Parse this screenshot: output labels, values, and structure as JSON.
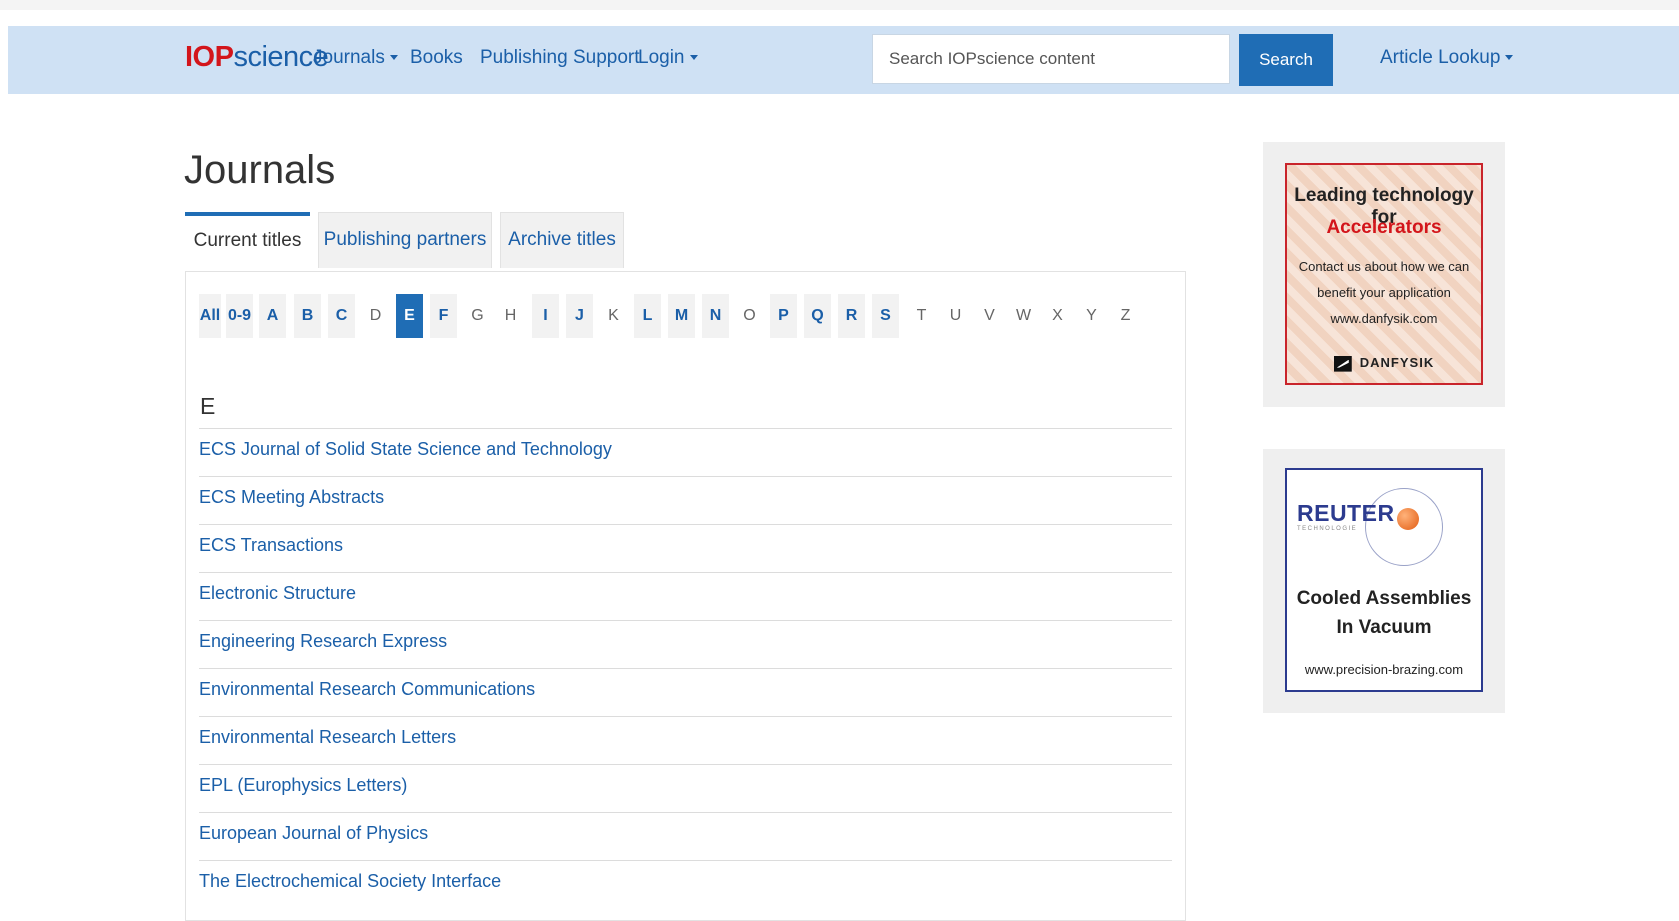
{
  "nav": {
    "logo_bold": "IOP",
    "logo_rest": "science",
    "journals": "Journals",
    "books": "Books",
    "publishing_support": "Publishing Support",
    "login": "Login",
    "search_placeholder": "Search IOPscience content",
    "search_button": "Search",
    "article_lookup": "Article Lookup"
  },
  "page": {
    "title": "Journals",
    "tabs": [
      {
        "label": "Current titles",
        "active": true
      },
      {
        "label": "Publishing partners",
        "active": false
      },
      {
        "label": "Archive titles",
        "active": false
      }
    ],
    "letters": [
      {
        "label": "All",
        "state": "has"
      },
      {
        "label": "0-9",
        "state": "has"
      },
      {
        "label": "A",
        "state": "has"
      },
      {
        "label": "B",
        "state": "has"
      },
      {
        "label": "C",
        "state": "has"
      },
      {
        "label": "D",
        "state": "no"
      },
      {
        "label": "E",
        "state": "sel"
      },
      {
        "label": "F",
        "state": "has"
      },
      {
        "label": "G",
        "state": "no"
      },
      {
        "label": "H",
        "state": "no"
      },
      {
        "label": "I",
        "state": "has"
      },
      {
        "label": "J",
        "state": "has"
      },
      {
        "label": "K",
        "state": "no"
      },
      {
        "label": "L",
        "state": "has"
      },
      {
        "label": "M",
        "state": "has"
      },
      {
        "label": "N",
        "state": "has"
      },
      {
        "label": "O",
        "state": "no"
      },
      {
        "label": "P",
        "state": "has"
      },
      {
        "label": "Q",
        "state": "has"
      },
      {
        "label": "R",
        "state": "has"
      },
      {
        "label": "S",
        "state": "has"
      },
      {
        "label": "T",
        "state": "no"
      },
      {
        "label": "U",
        "state": "no"
      },
      {
        "label": "V",
        "state": "no"
      },
      {
        "label": "W",
        "state": "no"
      },
      {
        "label": "X",
        "state": "no"
      },
      {
        "label": "Y",
        "state": "no"
      },
      {
        "label": "Z",
        "state": "no"
      }
    ],
    "section_letter": "E",
    "journals": [
      "ECS Journal of Solid State Science and Technology",
      "ECS Meeting Abstracts",
      "ECS Transactions",
      "Electronic Structure",
      "Engineering Research Express",
      "Environmental Research Communications",
      "Environmental Research Letters",
      "EPL (Europhysics Letters)",
      "European Journal of Physics",
      "The Electrochemical Society Interface"
    ]
  },
  "ads": {
    "danfysik": {
      "line1": "Leading technology for",
      "line2": "Accelerators",
      "line3": "Contact us about how we can",
      "line4": "benefit your application",
      "line5": "www.danfysik.com",
      "brand": "DANFYSIK"
    },
    "reuter": {
      "logo": "REUTER",
      "logo_sub": "TECHNOLOGIE",
      "line1": "Cooled Assemblies",
      "line2": "In Vacuum",
      "url": "www.precision-brazing.com"
    }
  },
  "colors": {
    "navbar_bg": "#cfe1f4",
    "link": "#1b5fa8",
    "accent": "#1f6db5",
    "logo_red": "#d3151b"
  }
}
